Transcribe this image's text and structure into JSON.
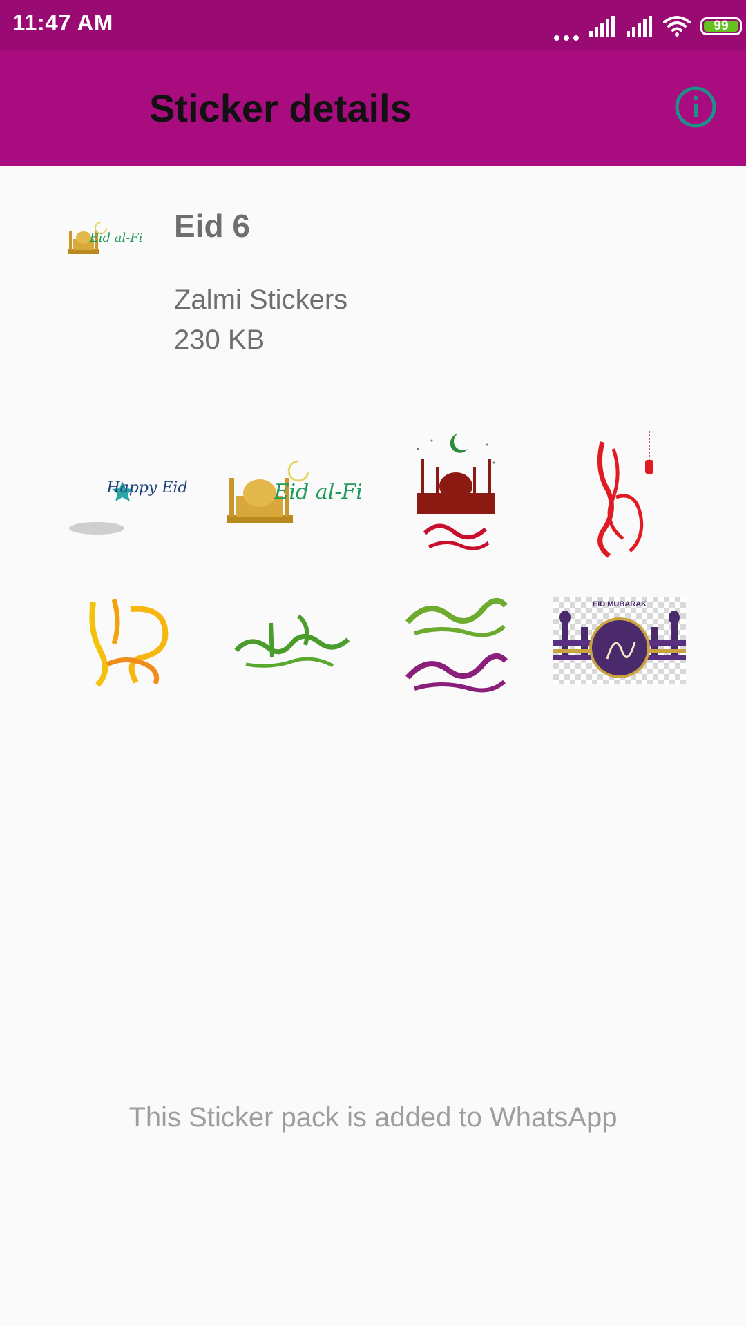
{
  "status_bar": {
    "time": "11:47 AM",
    "battery_level": "99",
    "battery_fraction": 0.99,
    "battery_color": "#64c11e",
    "icons": [
      "more-dots-icon",
      "signal-icon",
      "signal-icon",
      "wifi-icon",
      "battery-icon"
    ]
  },
  "app_bar": {
    "title": "Sticker details",
    "background": "#a80c7f",
    "info_icon": "info-icon",
    "info_icon_color": "#1f8f8a"
  },
  "pack": {
    "tray_icon": "eid-al-fitr-mosque-tray-icon",
    "tray_text": "Eid al-Fitr",
    "name": "Eid 6",
    "publisher": "Zalmi Stickers",
    "size": "230 KB"
  },
  "stickers": [
    {
      "icon": "happy-eid-crescent-sticker",
      "text": "Happy Eid"
    },
    {
      "icon": "eid-al-fitr-mosque-sticker",
      "text": "Eid al-Fitr"
    },
    {
      "icon": "mosque-crescent-eid-mubarak-sticker"
    },
    {
      "icon": "red-calligraphy-lantern-sticker"
    },
    {
      "icon": "orange-eid-mubarak-calligraphy-sticker"
    },
    {
      "icon": "green-eid-mubarak-calligraphy-sticker"
    },
    {
      "icon": "green-purple-eid-mubarak-calligraphy-sticker"
    },
    {
      "icon": "eid-mubarak-banner-sticker",
      "text": "EID MUBARAK"
    }
  ],
  "footer": {
    "status_text": "This Sticker pack is added to WhatsApp"
  }
}
